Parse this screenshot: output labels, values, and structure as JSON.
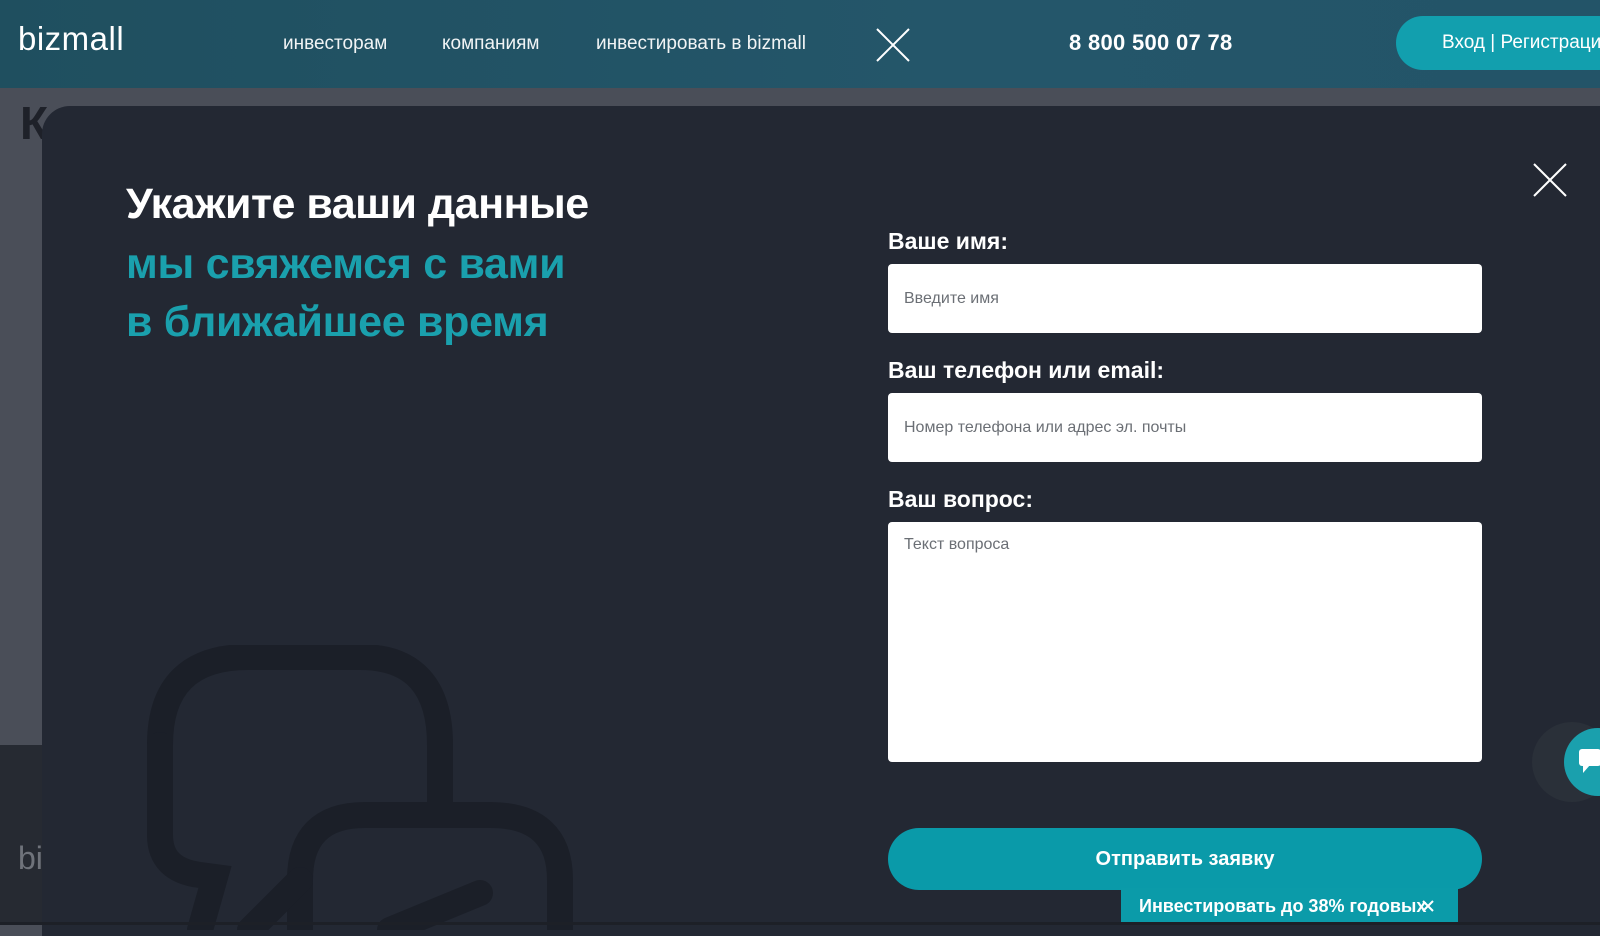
{
  "header": {
    "logo": "bizmall",
    "nav": [
      "инвесторам",
      "компаниям",
      "инвестировать в bizmall"
    ],
    "phone": "8 800 500 07 78",
    "login_label": "Вход | Регистрация"
  },
  "background": {
    "heading_fragment": "К",
    "footer_fragment": "bi"
  },
  "modal": {
    "title": "Укажите ваши данные",
    "subtitle_line1": "мы свяжемся с вами",
    "subtitle_line2": "в ближайшее время",
    "form": {
      "name_label": "Ваше имя:",
      "name_placeholder": "Введите имя",
      "contact_label": "Ваш телефон или email:",
      "contact_placeholder": "Номер телефона или адрес эл. почты",
      "question_label": "Ваш вопрос:",
      "question_placeholder": "Текст вопроса",
      "submit_label": "Отправить заявку"
    }
  },
  "promo": {
    "text": "Инвестировать до 38% годовых"
  },
  "colors": {
    "accent": "#0a9aa9",
    "header": "#24566a",
    "modal_bg": "#232833"
  },
  "icons": {
    "nav_close": "close-icon",
    "modal_close": "close-icon",
    "promo_close": "close-icon",
    "chat": "chat-icon",
    "decoration": "speech-bubbles-icon"
  }
}
